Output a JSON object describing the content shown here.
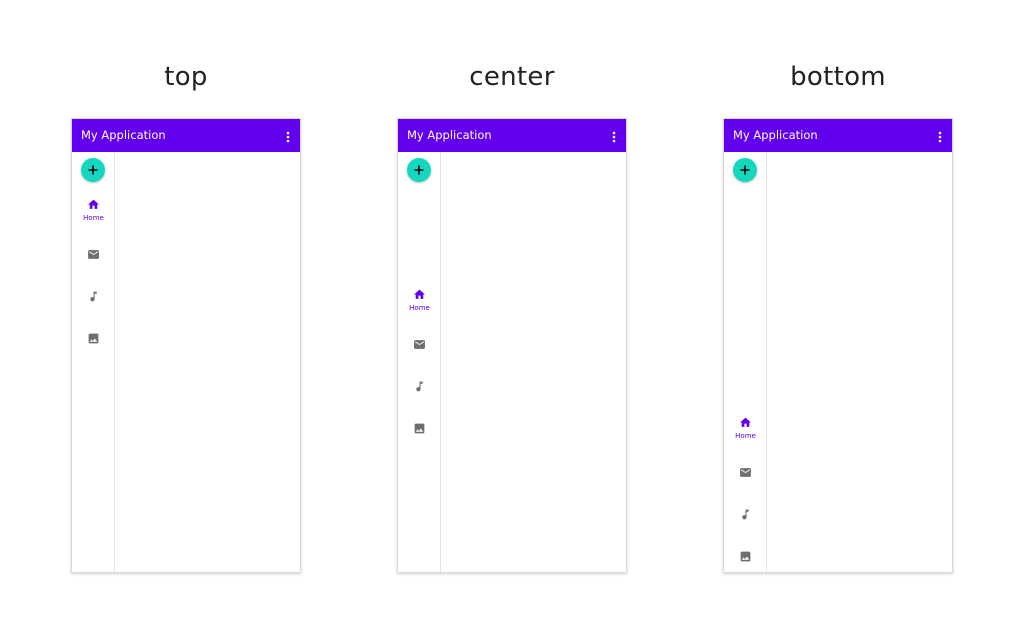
{
  "colors": {
    "primary": "#6200ee",
    "fab": "#14d7bf",
    "icon_inactive": "#6f6f6f",
    "icon_active": "#6200ee"
  },
  "variants": [
    {
      "caption": "top",
      "app_title": "My Application",
      "menu_icon": "more-vert-icon",
      "fab_icon": "add-icon",
      "rail_alignment": "top",
      "items": [
        {
          "icon": "home-icon",
          "label": "Home",
          "selected": true
        },
        {
          "icon": "mail-icon",
          "selected": false
        },
        {
          "icon": "music-note-icon",
          "selected": false
        },
        {
          "icon": "image-icon",
          "selected": false
        }
      ]
    },
    {
      "caption": "center",
      "app_title": "My Application",
      "menu_icon": "more-vert-icon",
      "fab_icon": "add-icon",
      "rail_alignment": "center",
      "items": [
        {
          "icon": "home-icon",
          "label": "Home",
          "selected": true
        },
        {
          "icon": "mail-icon",
          "selected": false
        },
        {
          "icon": "music-note-icon",
          "selected": false
        },
        {
          "icon": "image-icon",
          "selected": false
        }
      ]
    },
    {
      "caption": "bottom",
      "app_title": "My Application",
      "menu_icon": "more-vert-icon",
      "fab_icon": "add-icon",
      "rail_alignment": "bottom",
      "items": [
        {
          "icon": "home-icon",
          "label": "Home",
          "selected": true
        },
        {
          "icon": "mail-icon",
          "selected": false
        },
        {
          "icon": "music-note-icon",
          "selected": false
        },
        {
          "icon": "image-icon",
          "selected": false
        }
      ]
    }
  ]
}
